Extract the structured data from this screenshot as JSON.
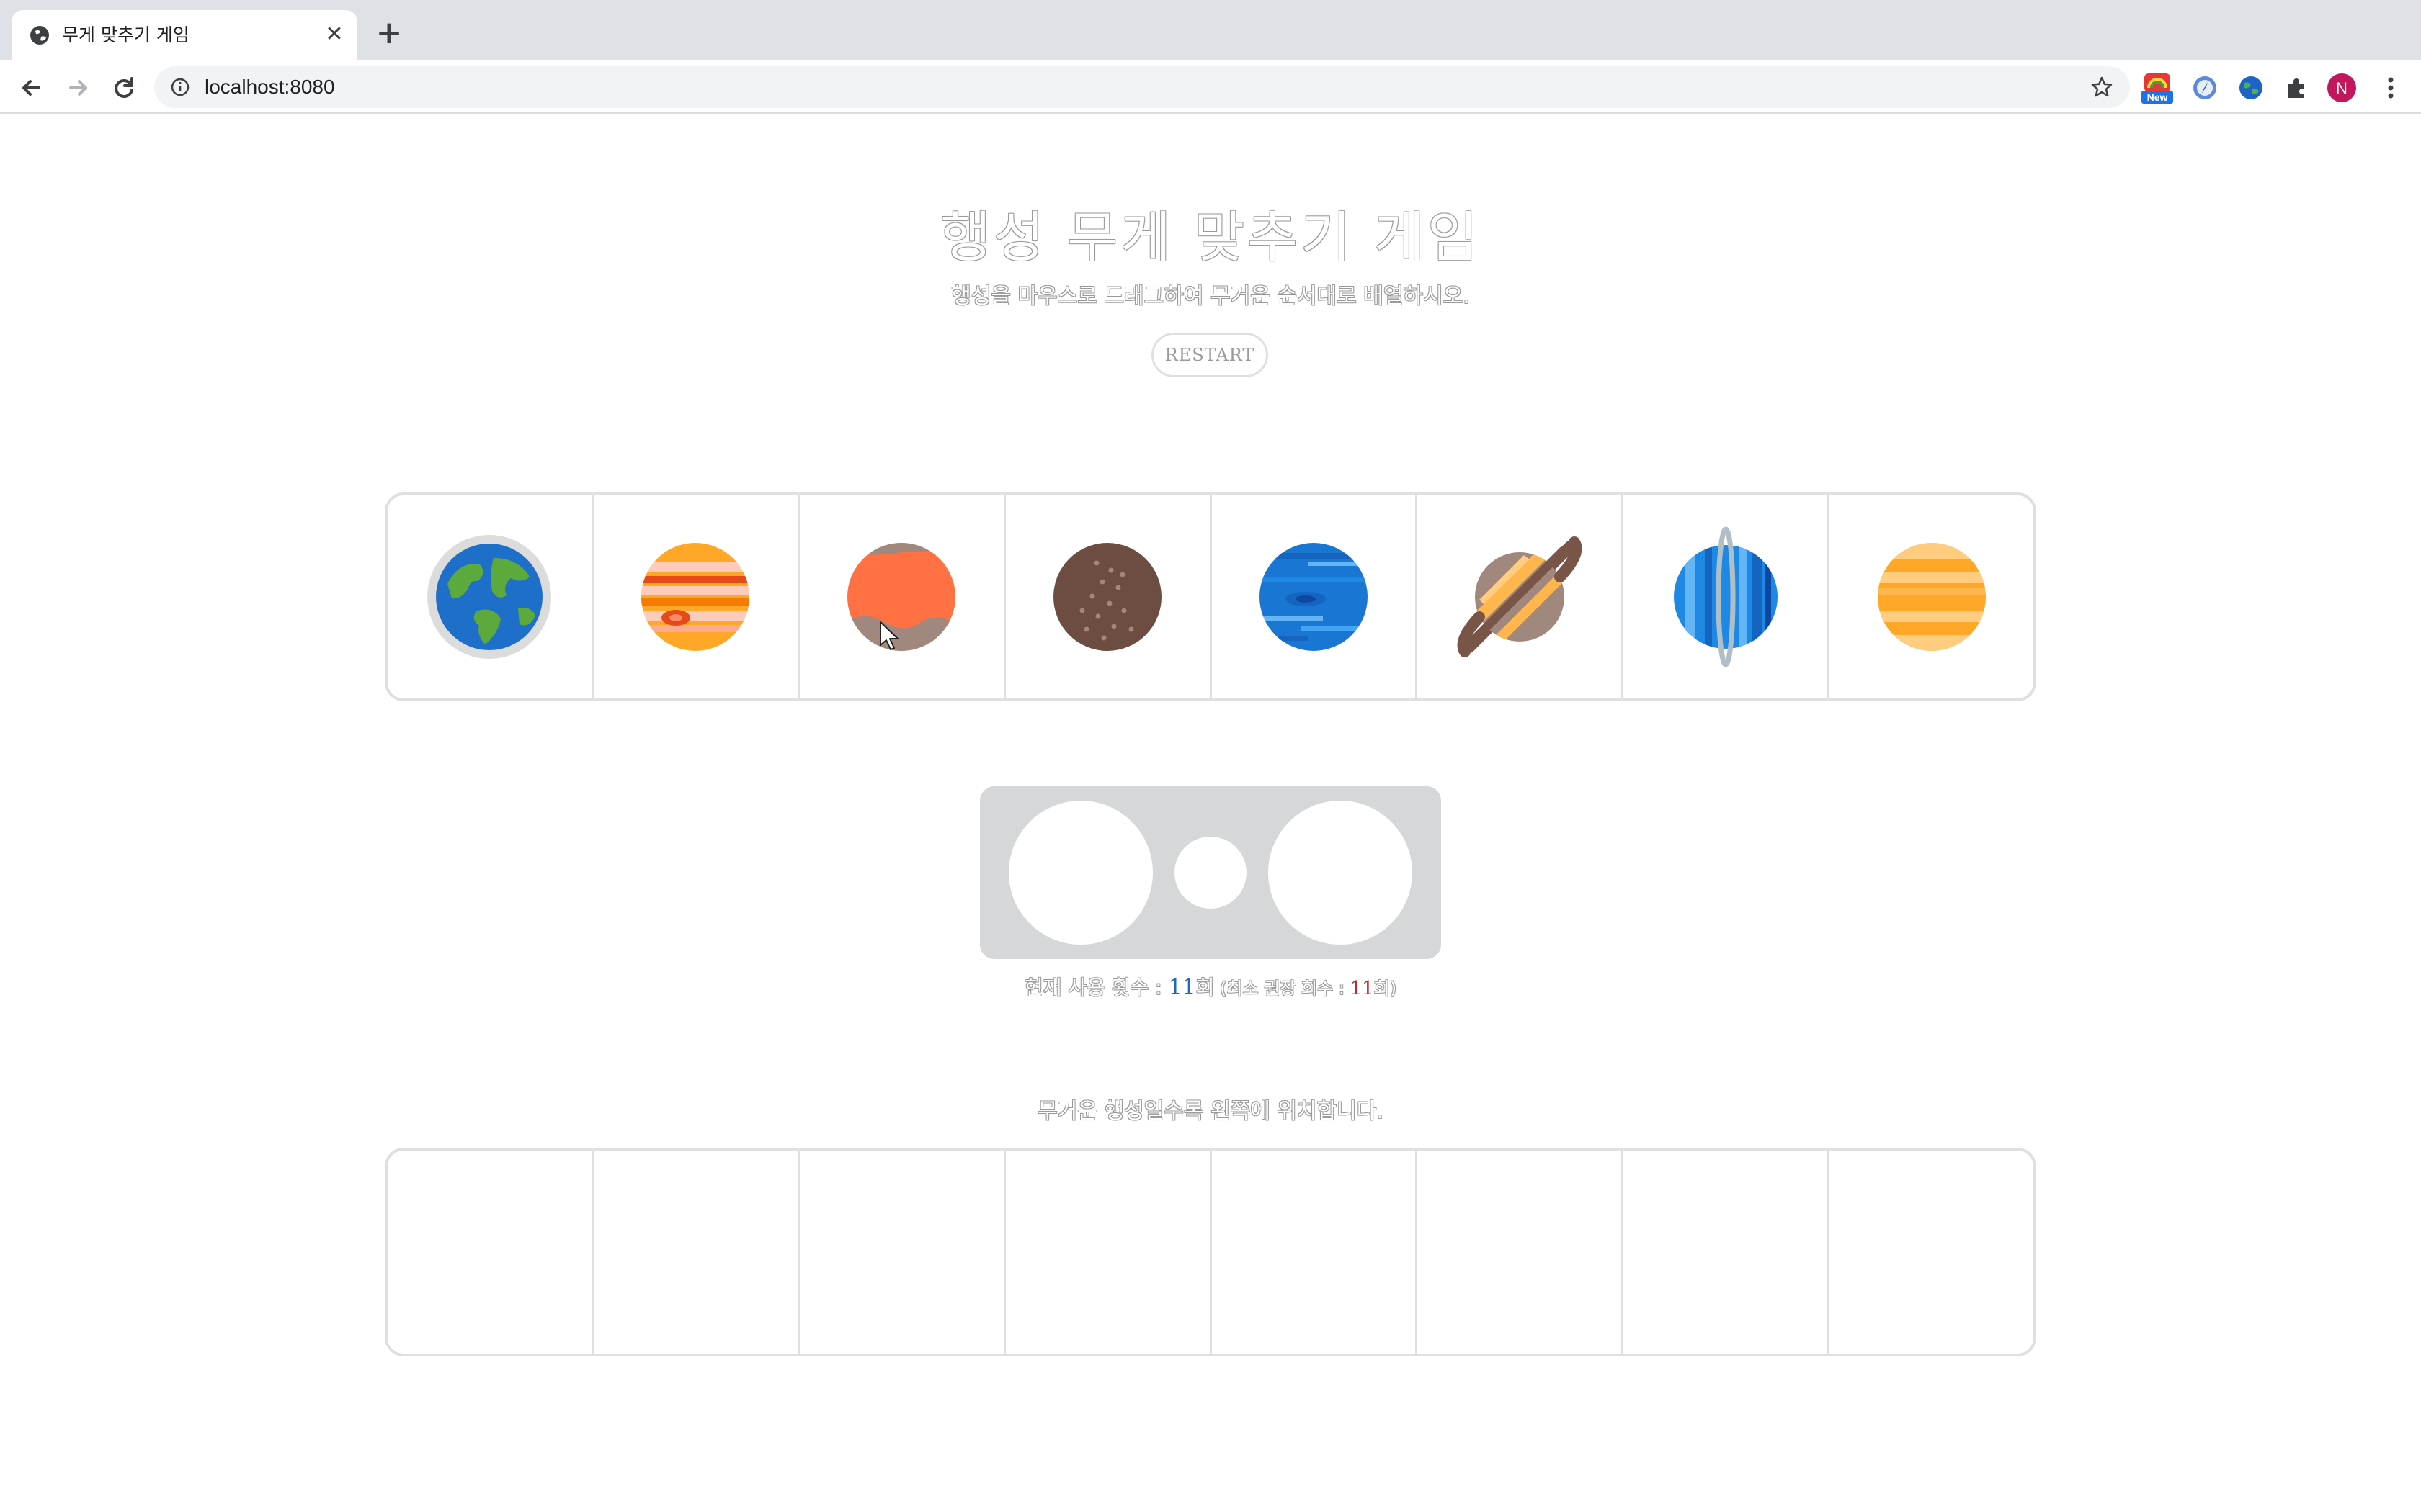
{
  "browser": {
    "tab_title": "무게 맞추기 게임",
    "url": "localhost:8080",
    "profile_initial": "N",
    "extension_badge": "New"
  },
  "page": {
    "title": "행성 무게 맞추기 게임",
    "subtitle": "행성을 마우스로 드래그하여 무거운 순서대로 배열하시오.",
    "restart_label": "RESTART",
    "counter": {
      "prefix": "현재 사용 횟수 : ",
      "current": "11",
      "current_unit": "회",
      "recommend_prefix": " (최소 권장 회수 : ",
      "recommend": "11",
      "recommend_suffix": "회)"
    },
    "hint": "무거운 행성일수록 왼쪽에 위치합니다."
  },
  "planets": [
    "earth-planet-icon",
    "jupiter-planet-icon",
    "mars-planet-icon",
    "mercury-planet-icon",
    "neptune-planet-icon",
    "saturn-planet-icon",
    "uranus-planet-icon",
    "venus-planet-icon"
  ],
  "colors": {
    "chrome_bg": "#dee1e6",
    "border": "#e0e0e0",
    "scale_bg": "#d6d7d9",
    "counter_blue": "#2468b0",
    "counter_red": "#c0282c",
    "avatar": "#c2185b"
  }
}
